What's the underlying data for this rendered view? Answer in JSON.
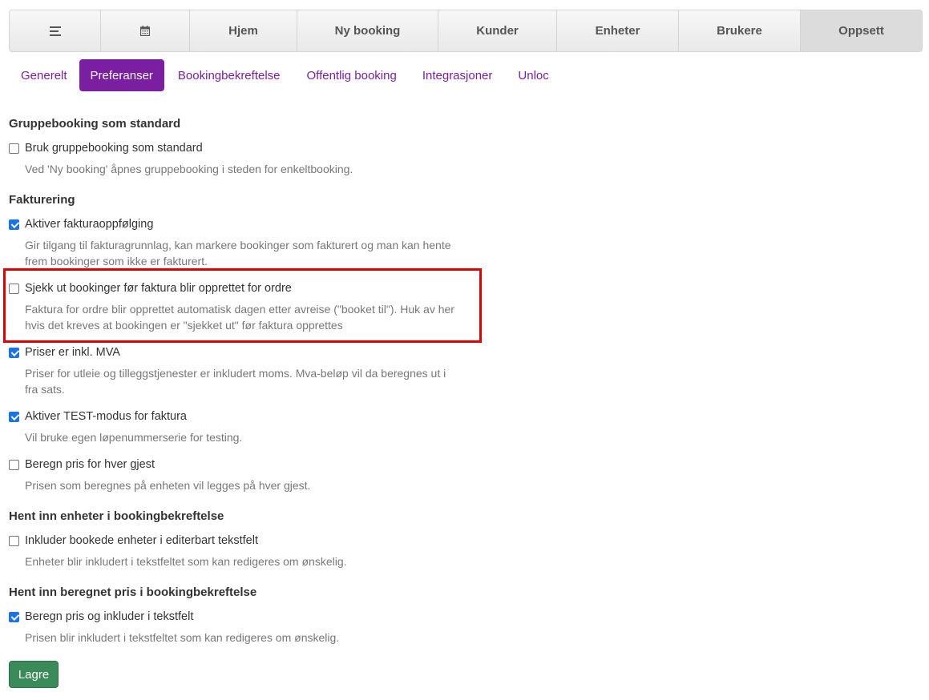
{
  "topnav": {
    "items": [
      {
        "label": "",
        "icon": "menu-icon"
      },
      {
        "label": "",
        "icon": "calendar-icon"
      },
      {
        "label": "Hjem"
      },
      {
        "label": "Ny booking"
      },
      {
        "label": "Kunder"
      },
      {
        "label": "Enheter"
      },
      {
        "label": "Brukere"
      },
      {
        "label": "Oppsett",
        "active": true
      }
    ]
  },
  "subtabs": [
    {
      "label": "Generelt"
    },
    {
      "label": "Preferanser",
      "active": true
    },
    {
      "label": "Bookingbekreftelse"
    },
    {
      "label": "Offentlig booking"
    },
    {
      "label": "Integrasjoner"
    },
    {
      "label": "Unloc"
    }
  ],
  "sections": {
    "group_booking": {
      "title": "Gruppebooking som standard",
      "opt1": {
        "label": "Bruk gruppebooking som standard",
        "checked": false,
        "desc": "Ved 'Ny booking' åpnes gruppebooking i steden for enkeltbooking."
      }
    },
    "invoicing": {
      "title": "Fakturering",
      "opt1": {
        "label": "Aktiver fakturaoppfølging",
        "checked": true,
        "desc": "Gir tilgang til fakturagrunnlag, kan markere bookinger som fakturert og man kan hente frem bookinger som ikke er fakturert."
      },
      "opt2": {
        "label": "Sjekk ut bookinger før faktura blir opprettet for ordre",
        "checked": false,
        "desc": "Faktura for ordre blir opprettet automatisk dagen etter avreise (\"booket til\"). Huk av her hvis det kreves at bookingen er \"sjekket ut\" før faktura opprettes"
      },
      "opt3": {
        "label": "Priser er inkl. MVA",
        "checked": true,
        "desc": "Priser for utleie og tilleggstjenester er inkludert moms. Mva-beløp vil da beregnes ut i fra sats."
      },
      "opt4": {
        "label": "Aktiver TEST-modus for faktura",
        "checked": true,
        "desc": "Vil bruke egen løpenummerserie for testing."
      },
      "opt5": {
        "label": "Beregn pris for hver gjest",
        "checked": false,
        "desc": "Prisen som beregnes på enheten vil legges på hver gjest."
      }
    },
    "units": {
      "title": "Hent inn enheter i bookingbekreftelse",
      "opt1": {
        "label": "Inkluder bookede enheter i editerbart tekstfelt",
        "checked": false,
        "desc": "Enheter blir inkludert i tekstfeltet som kan redigeres om ønskelig."
      }
    },
    "price": {
      "title": "Hent inn beregnet pris i bookingbekreftelse",
      "opt1": {
        "label": "Beregn pris og inkluder i tekstfelt",
        "checked": true,
        "desc": "Prisen blir inkludert i tekstfeltet som kan redigeres om ønskelig."
      }
    }
  },
  "save_label": "Lagre",
  "highlight_color": "#e00000",
  "accent_color": "#7b1fa2"
}
